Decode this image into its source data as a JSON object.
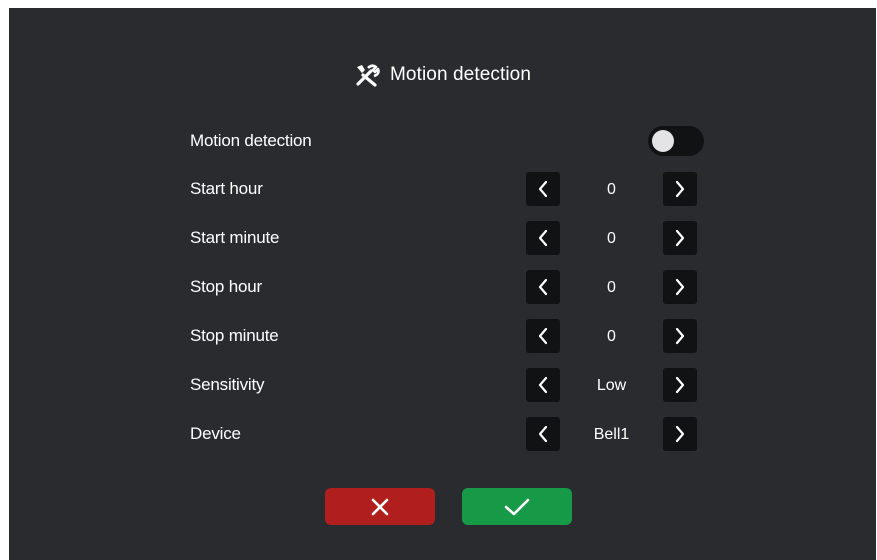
{
  "screen": {
    "title": "Motion detection",
    "title_icon": "tools-icon",
    "background": "#292b2f"
  },
  "settings": {
    "motion_detection": {
      "label": "Motion detection",
      "enabled": false
    },
    "rows": [
      {
        "key": "start_hour",
        "label": "Start hour",
        "value": "0"
      },
      {
        "key": "start_minute",
        "label": "Start minute",
        "value": "0"
      },
      {
        "key": "stop_hour",
        "label": "Stop hour",
        "value": "0"
      },
      {
        "key": "stop_minute",
        "label": "Stop minute",
        "value": "0"
      },
      {
        "key": "sensitivity",
        "label": "Sensitivity",
        "value": "Low"
      },
      {
        "key": "device",
        "label": "Device",
        "value": "Bell1"
      }
    ],
    "decrement_icon": "chevron-left-icon",
    "increment_icon": "chevron-right-icon"
  },
  "actions": {
    "cancel": {
      "icon": "close-icon",
      "color": "#b11e1e"
    },
    "confirm": {
      "icon": "check-icon",
      "color": "#179a47"
    }
  }
}
